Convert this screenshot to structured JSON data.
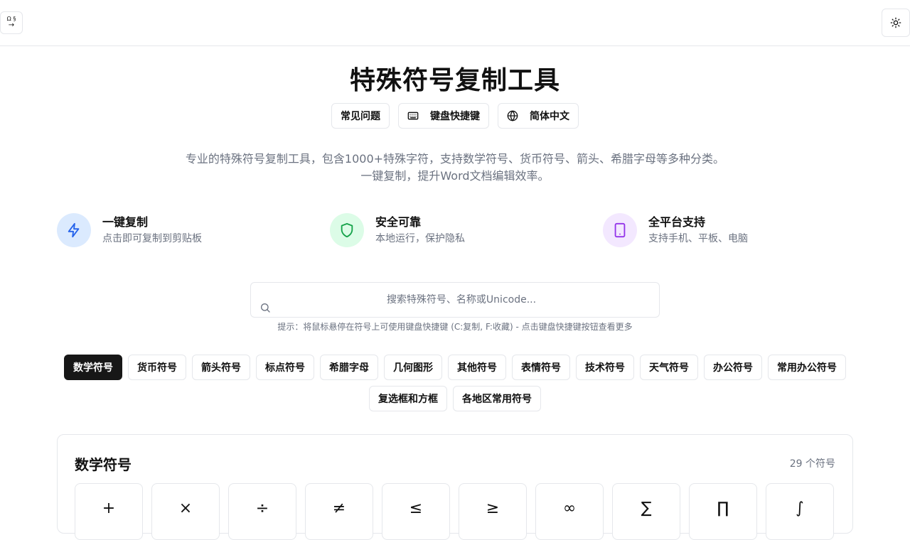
{
  "header": {
    "logo_top": "Ω §",
    "logo_bottom": "→",
    "theme_icon": "sun-icon"
  },
  "title": "特殊符号复制工具",
  "actions": [
    {
      "label": "常见问题",
      "icon": ""
    },
    {
      "label": "键盘快捷键",
      "icon": "keyboard-icon"
    },
    {
      "label": "简体中文",
      "icon": "globe-icon"
    }
  ],
  "description": {
    "line1": "专业的特殊符号复制工具，包含1000+特殊字符，支持数学符号、货币符号、箭头、希腊字母等多种分类。",
    "line2": "一键复制，提升Word文档编辑效率。"
  },
  "features": [
    {
      "title": "一键复制",
      "desc": "点击即可复制到剪贴板",
      "icon": "lightning-icon",
      "bg": "#dbeafe",
      "color": "#2563eb"
    },
    {
      "title": "安全可靠",
      "desc": "本地运行，保护隐私",
      "icon": "shield-icon",
      "bg": "#dcfce7",
      "color": "#16a34a"
    },
    {
      "title": "全平台支持",
      "desc": "支持手机、平板、电脑",
      "icon": "tablet-icon",
      "bg": "#f3e8ff",
      "color": "#9333ea"
    }
  ],
  "search": {
    "placeholder": "搜索特殊符号、名称或Unicode...",
    "value": ""
  },
  "hint": "提示：将鼠标悬停在符号上可使用键盘快捷键 (C:复制, F:收藏) - 点击键盘快捷键按钮查看更多",
  "categories": [
    "数学符号",
    "货币符号",
    "箭头符号",
    "标点符号",
    "希腊字母",
    "几何图形",
    "其他符号",
    "表情符号",
    "技术符号",
    "天气符号",
    "办公符号",
    "常用办公符号",
    "复选框和方框",
    "各地区常用符号"
  ],
  "active_category": "数学符号",
  "panel": {
    "title": "数学符号",
    "count": "29 个符号",
    "symbols": [
      "+",
      "×",
      "÷",
      "≠",
      "≤",
      "≥",
      "∞",
      "∑",
      "∏",
      "∫"
    ]
  },
  "colors": {
    "accent_dark": "#171717",
    "border": "#e5e7eb",
    "muted_text": "#6b7280"
  }
}
